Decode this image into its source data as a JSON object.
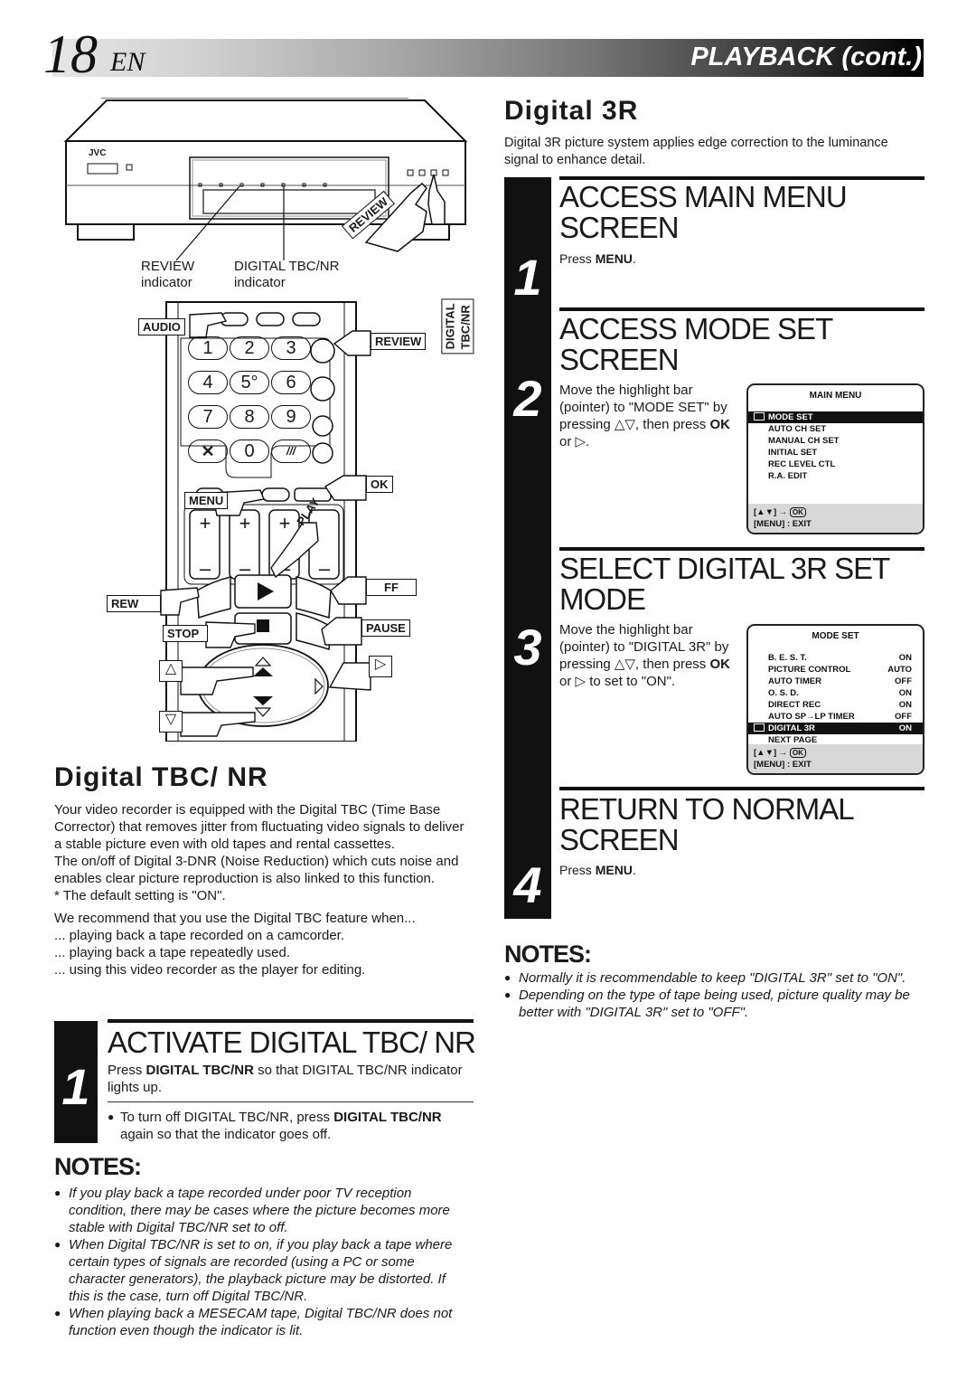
{
  "header": {
    "page_number": "18",
    "language": "EN",
    "section": "PLAYBACK (cont.)"
  },
  "illustration": {
    "brand": "JVC",
    "vcr_labels": {
      "review_indicator_l1": "REVIEW",
      "review_indicator_l2": "indicator",
      "tbc_indicator_l1": "DIGITAL TBC/NR",
      "tbc_indicator_l2": "indicator",
      "review_button": "REVIEW",
      "tbc_button": "DIGITAL TBC/NR"
    },
    "remote_labels": {
      "audio": "AUDIO",
      "review": "REVIEW",
      "ok": "OK",
      "menu": "MENU",
      "play": "PLAY",
      "rew": "REW",
      "ff": "FF",
      "stop": "STOP",
      "pause": "PAUSE",
      "up": "△",
      "down": "▽",
      "right": "▷"
    },
    "keypad": [
      "1",
      "2",
      "3",
      "4",
      "5°",
      "6",
      "7",
      "8",
      "9",
      "✕",
      "0",
      "///"
    ]
  },
  "tbc": {
    "title": "Digital TBC/ NR",
    "para1": "Your video recorder is equipped with the Digital TBC (Time Base Corrector) that removes jitter from fluctuating video signals to deliver a stable picture even with old tapes and rental cassettes.",
    "para2": "The on/off of Digital 3-DNR (Noise Reduction) which cuts noise and enables clear picture reproduction is also linked to this function.",
    "default_note": "* The default setting is \"ON\".",
    "recommend": "We recommend that you use the Digital TBC feature when...",
    "uses": [
      "... playing back a tape recorded on a camcorder.",
      "... playing back a tape repeatedly used.",
      "... using this video recorder as the player for editing."
    ],
    "step": {
      "number": "1",
      "title": "ACTIVATE DIGITAL TBC/ NR",
      "text_pre": "Press ",
      "text_kw": "DIGITAL TBC/NR",
      "text_post": " so that DIGITAL TBC/NR indicator lights up.",
      "bullet_pre": "To turn off DIGITAL TBC/NR, press ",
      "bullet_kw": "DIGITAL TBC/NR",
      "bullet_post": " again so that the indicator goes off."
    },
    "notes_title": "NOTES:",
    "notes": [
      "If you play back a tape recorded under poor TV reception condition, there may be cases where the picture becomes more stable with Digital TBC/NR set to off.",
      "When Digital TBC/NR is set to on, if you play back a tape where certain types of signals are recorded (using a PC or some character generators), the playback picture may be distorted. If this is the case, turn off Digital TBC/NR.",
      "When playing back a MESECAM tape, Digital TBC/NR does not function even though the indicator is lit."
    ]
  },
  "d3r": {
    "title": "Digital 3R",
    "intro": "Digital 3R picture system applies edge correction to the luminance signal to enhance detail.",
    "steps": [
      {
        "number": "1",
        "title": "ACCESS MAIN MENU SCREEN",
        "text_pre": "Press ",
        "text_kw": "MENU",
        "text_post": "."
      },
      {
        "number": "2",
        "title": "ACCESS MODE SET SCREEN",
        "text_pre": "Move the highlight bar (pointer) to \"MODE SET\" by pressing △▽, then press ",
        "text_kw": "OK",
        "text_post": " or ▷."
      },
      {
        "number": "3",
        "title": "SELECT DIGITAL 3R SET MODE",
        "text_pre": "Move the highlight bar (pointer) to \"DIGITAL 3R\" by pressing △▽, then press ",
        "text_kw": "OK",
        "text_post": " or ▷ to set to \"ON\"."
      },
      {
        "number": "4",
        "title": "RETURN TO NORMAL SCREEN",
        "text_pre": "Press ",
        "text_kw": "MENU",
        "text_post": "."
      }
    ],
    "main_menu": {
      "title": "MAIN MENU",
      "items": [
        "MODE SET",
        "AUTO CH SET",
        "MANUAL CH SET",
        "INITIAL SET",
        "REC LEVEL CTL",
        "R.A. EDIT"
      ],
      "selected": "MODE SET",
      "foot_nav": "[▲▼] →",
      "foot_ok": "OK",
      "foot_exit": "[MENU] : EXIT"
    },
    "mode_set_menu": {
      "title": "MODE SET",
      "items": [
        {
          "label": "B. E. S. T.",
          "value": "ON"
        },
        {
          "label": "PICTURE CONTROL",
          "value": "AUTO"
        },
        {
          "label": "AUTO TIMER",
          "value": "OFF"
        },
        {
          "label": "O. S. D.",
          "value": "ON"
        },
        {
          "label": "DIRECT REC",
          "value": "ON"
        },
        {
          "label": "AUTO SP→LP TIMER",
          "value": "OFF"
        },
        {
          "label": "DIGITAL 3R",
          "value": "ON"
        },
        {
          "label": "NEXT PAGE",
          "value": ""
        }
      ],
      "selected": "DIGITAL 3R",
      "foot_nav": "[▲▼] →",
      "foot_ok": "OK",
      "foot_exit": "[MENU] : EXIT"
    },
    "notes_title": "NOTES:",
    "notes": [
      "Normally it is recommendable to keep \"DIGITAL 3R\" set to \"ON\".",
      "Depending on the type of tape being used, picture quality may be better with \"DIGITAL 3R\" set to \"OFF\"."
    ]
  }
}
